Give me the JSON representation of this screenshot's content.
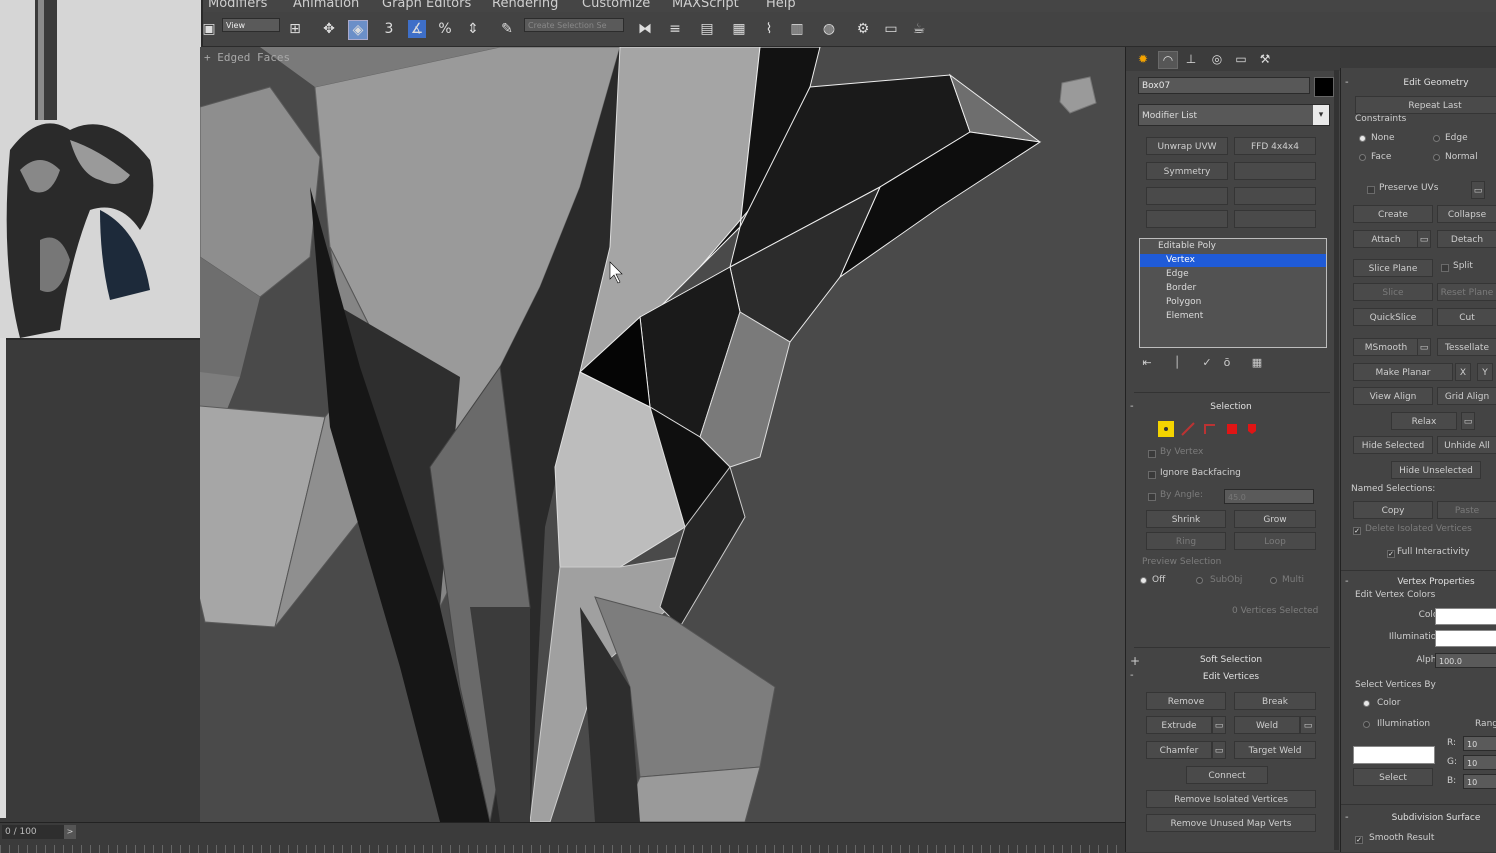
{
  "menu": [
    "Modifiers",
    "Animation",
    "Graph Editors",
    "Rendering",
    "Customize",
    "MAXScript",
    "Help"
  ],
  "toolbar": {
    "view_select": "View",
    "selection_set_placeholder": "Create Selection Se",
    "snap_value": "3"
  },
  "viewport": {
    "label": "+ Edged Faces"
  },
  "timeline": {
    "frame": "0 / 100",
    "arrow": ">"
  },
  "command_panel": {
    "object_name": "Box07",
    "modifier_list": "Modifier List",
    "buttons": [
      "Unwrap UVW",
      "FFD 4x4x4",
      "Symmetry",
      "",
      "",
      "",
      "",
      ""
    ],
    "stack": [
      "Editable Poly",
      "Vertex",
      "Edge",
      "Border",
      "Polygon",
      "Element"
    ],
    "selection": {
      "title": "Selection",
      "by_vertex": "By Vertex",
      "ignore_backfacing": "Ignore Backfacing",
      "by_angle": "By Angle:",
      "angle_value": "45.0",
      "shrink": "Shrink",
      "grow": "Grow",
      "ring": "Ring",
      "loop": "Loop",
      "preview_selection": "Preview Selection",
      "preview_off": "Off",
      "preview_subobj": "SubObj",
      "preview_multi": "Multi",
      "status": "0 Vertices Selected"
    },
    "soft_selection": "Soft Selection",
    "edit_vertices": {
      "title": "Edit Vertices",
      "remove": "Remove",
      "break": "Break",
      "extrude": "Extrude",
      "weld": "Weld",
      "chamfer": "Chamfer",
      "target_weld": "Target Weld",
      "connect": "Connect",
      "remove_isolated": "Remove Isolated Vertices",
      "remove_unused_map": "Remove Unused Map Verts"
    }
  },
  "right_panel": {
    "edit_geometry": "Edit Geometry",
    "repeat_last": "Repeat Last",
    "constraints": "Constraints",
    "c_none": "None",
    "c_edge": "Edge",
    "c_face": "Face",
    "c_normal": "Normal",
    "preserve_uvs": "Preserve UVs",
    "create": "Create",
    "collapse": "Collapse",
    "attach": "Attach",
    "detach": "Detach",
    "slice_plane": "Slice Plane",
    "split": "Split",
    "slice": "Slice",
    "reset_plane": "Reset Plane",
    "quickslice": "QuickSlice",
    "cut": "Cut",
    "msmooth": "MSmooth",
    "tessellate": "Tessellate",
    "make_planar": "Make Planar",
    "x": "X",
    "y": "Y",
    "view_align": "View Align",
    "grid_align": "Grid Align",
    "relax": "Relax",
    "hide_selected": "Hide Selected",
    "unhide_all": "Unhide All",
    "hide_unselected": "Hide Unselected",
    "named_selections": "Named Selections:",
    "copy": "Copy",
    "paste": "Paste",
    "delete_isolated": "Delete Isolated Vertices",
    "full_interactivity": "Full Interactivity",
    "vertex_properties": "Vertex Properties",
    "edit_vertex_colors": "Edit Vertex Colors",
    "color": "Color:",
    "illumination": "Illumination:",
    "alpha": "Alpha:",
    "alpha_value": "100.0",
    "select_vertices_by": "Select Vertices By",
    "sv_color": "Color",
    "sv_illumination": "Illumination",
    "range": "Range:",
    "r": "R:",
    "g": "G:",
    "b": "B:",
    "rv": "10",
    "gv": "10",
    "bv": "10",
    "select": "Select",
    "subdivision_surface": "Subdivision Surface",
    "smooth_result": "Smooth Result"
  },
  "colors": {
    "selection_blue": "#1f5bd8",
    "vertex_yellow": "#f4d400",
    "element_red": "#e01515"
  }
}
